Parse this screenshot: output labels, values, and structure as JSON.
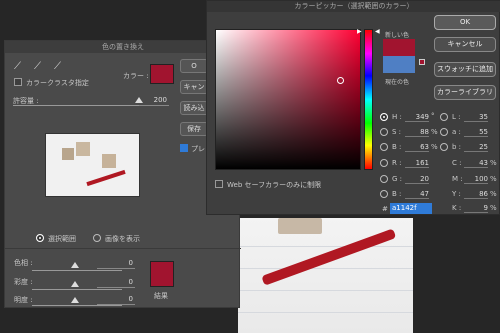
{
  "replace_dialog": {
    "title": "色の置き換え",
    "color_label": "カラー :",
    "cluster_label": "カラークラスタ指定",
    "tolerance_label": "許容量 :",
    "tolerance_value": "200",
    "buttons": [
      "O",
      "キャン",
      "読み込",
      "保存"
    ],
    "preview_label": "プレビ",
    "selection_label": "選択範囲",
    "image_label": "画像を表示",
    "hue_label": "色相 :",
    "hue_value": "0",
    "saturation_label": "彩度 :",
    "saturation_value": "0",
    "lightness_label": "明度 :",
    "lightness_value": "0",
    "result_label": "結果"
  },
  "color_picker": {
    "title": "カラーピッカー（選択範囲のカラー）",
    "ok": "OK",
    "cancel": "キャンセル",
    "add_swatch": "スウォッチに追加",
    "color_library": "カラーライブラリ",
    "new_label": "新しい色",
    "current_label": "現在の色",
    "web_only_label": "Web セーフカラーのみに制限",
    "fields": [
      {
        "key": "H",
        "label": "H :",
        "value": "349",
        "unit": "°"
      },
      {
        "key": "S",
        "label": "S :",
        "value": "88",
        "unit": "%"
      },
      {
        "key": "B",
        "label": "B :",
        "value": "63",
        "unit": "%"
      },
      {
        "key": "R",
        "label": "R :",
        "value": "161",
        "unit": ""
      },
      {
        "key": "G",
        "label": "G :",
        "value": "20",
        "unit": ""
      },
      {
        "key": "B2",
        "label": "B :",
        "value": "47",
        "unit": ""
      }
    ],
    "lab_fields": [
      {
        "label": "L :",
        "value": "35"
      },
      {
        "label": "a :",
        "value": "55"
      },
      {
        "label": "b :",
        "value": "25"
      }
    ],
    "cmyk_fields": [
      {
        "label": "C :",
        "value": "43",
        "unit": "%"
      },
      {
        "label": "M :",
        "value": "100",
        "unit": "%"
      },
      {
        "label": "Y :",
        "value": "86",
        "unit": "%"
      },
      {
        "label": "K :",
        "value": "9",
        "unit": "%"
      }
    ],
    "hex_label": "#",
    "hex_value": "a1142f"
  },
  "colors": {
    "new_color": "#a1142f",
    "current_color": "#4f7fc4",
    "accent": "#2f7bd8"
  }
}
